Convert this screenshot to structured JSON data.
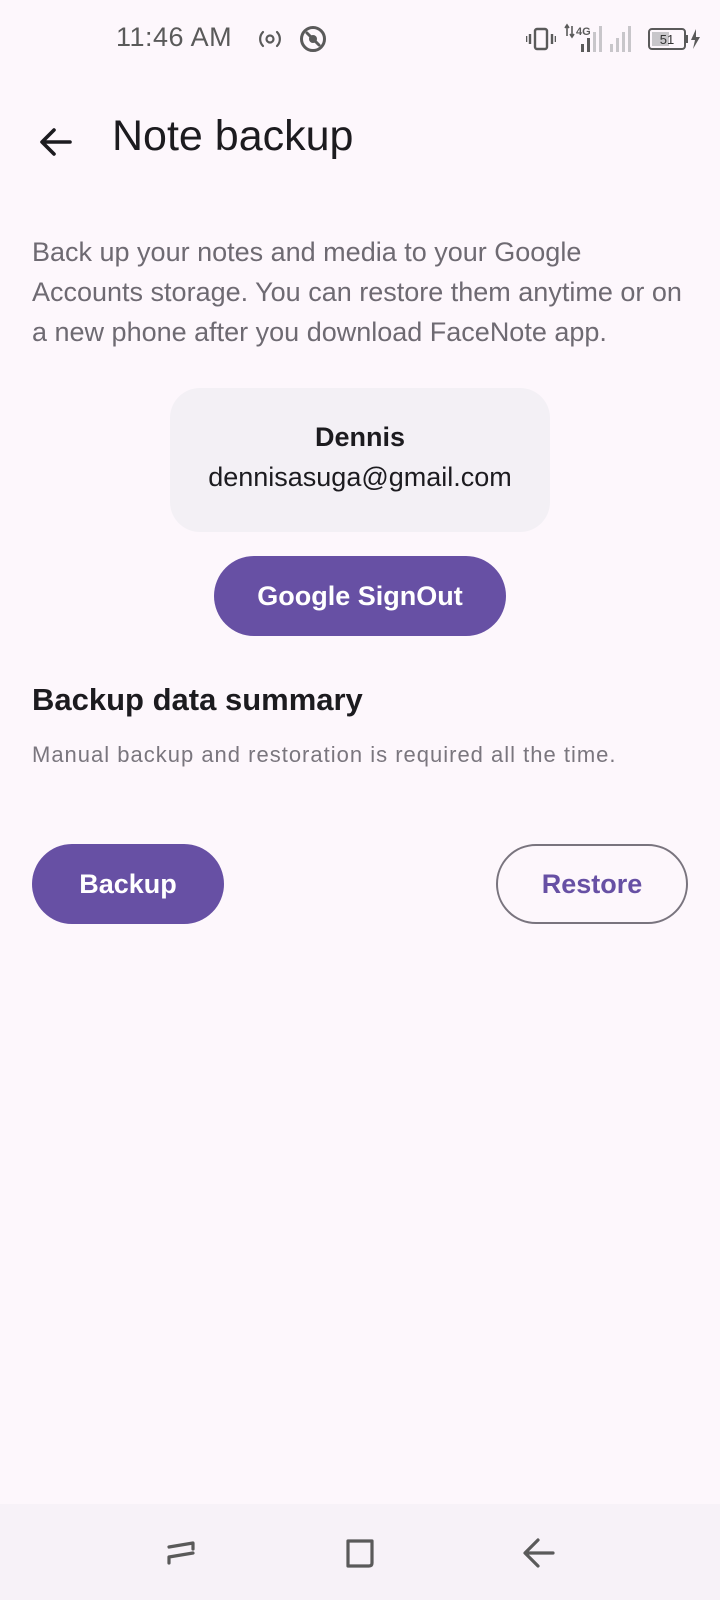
{
  "status_bar": {
    "time": "11:46 AM",
    "network": "4G",
    "battery": "51",
    "icons": [
      "hotspot-icon",
      "vpn-icon",
      "vibrate-icon",
      "signal-icon",
      "battery-icon",
      "charging-icon"
    ]
  },
  "app_bar": {
    "back_icon": "arrow-back-icon",
    "title": "Note backup"
  },
  "description": "Back up your notes and media to your Google Accounts storage. You can restore them anytime or on a new phone after you download FaceNote app.",
  "account": {
    "name": "Dennis",
    "email": "dennisasuga@gmail.com"
  },
  "signout_label": "Google SignOut",
  "summary": {
    "heading": "Backup data summary",
    "text": "Manual backup and restoration is required all the time."
  },
  "actions": {
    "backup_label": "Backup",
    "restore_label": "Restore"
  },
  "nav_bar": {
    "icons": [
      "recents-icon",
      "home-icon",
      "back-icon"
    ]
  },
  "colors": {
    "background": "#fdf7fc",
    "primary": "#6750a4",
    "card": "#f3f0f5",
    "outline": "#79747e"
  }
}
